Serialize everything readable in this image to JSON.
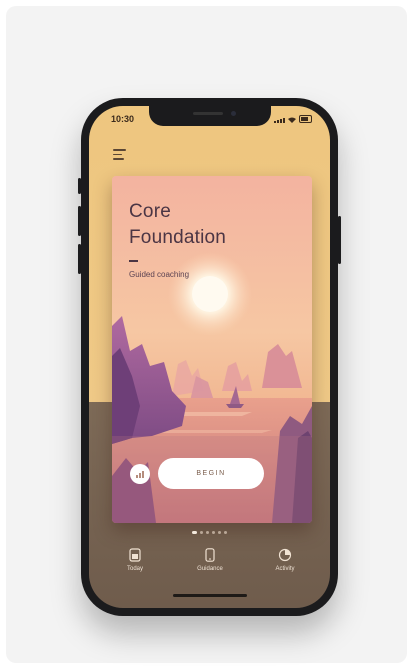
{
  "status_bar": {
    "time": "10:30"
  },
  "card": {
    "title_line1": "Core",
    "title_line2": "Foundation",
    "subtitle": "Guided coaching",
    "begin_label": "BEGIN"
  },
  "pager": {
    "total": 6,
    "active": 0
  },
  "tabs": [
    {
      "label": "Today",
      "icon": "today-icon"
    },
    {
      "label": "Guidance",
      "icon": "phone-icon"
    },
    {
      "label": "Activity",
      "icon": "activity-icon"
    }
  ],
  "colors": {
    "screen_top": "#eec67f",
    "card_title": "#4b3544",
    "tab_text": "#f1e3d3"
  }
}
